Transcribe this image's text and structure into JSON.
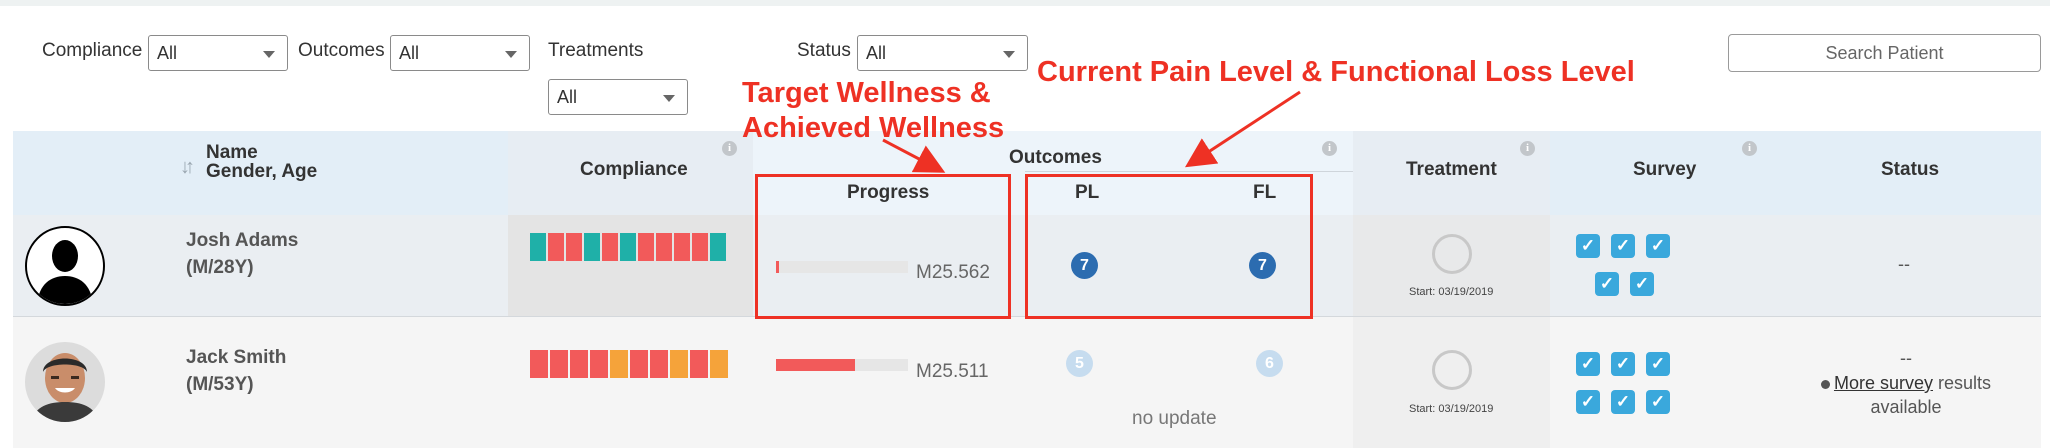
{
  "filters": {
    "compliance": {
      "label": "Compliance",
      "value": "All"
    },
    "outcomes": {
      "label": "Outcomes",
      "value": "All"
    },
    "treatments": {
      "label": "Treatments",
      "value": "All"
    },
    "status": {
      "label": "Status",
      "value": "All"
    },
    "search_label": "Search Patient"
  },
  "annotations": {
    "wellness_line1": "Target Wellness &",
    "wellness_line2": "Achieved Wellness",
    "pain": "Current Pain Level & Functional Loss Level"
  },
  "table": {
    "headers": {
      "name": "Name",
      "gender_age": "Gender, Age",
      "compliance": "Compliance",
      "outcomes": "Outcomes",
      "progress": "Progress",
      "pl": "PL",
      "fl": "FL",
      "treatment": "Treatment",
      "survey": "Survey",
      "status": "Status",
      "info_glyph": "i"
    },
    "rows": [
      {
        "name": "Josh Adams",
        "gender_age": "(M/28Y)",
        "avatar": "silhouette-avatar",
        "compliance_segments": [
          "#1fb0a8",
          "#f25a5a",
          "#f25a5a",
          "#1fb0a8",
          "#f25a5a",
          "#1fb0a8",
          "#f25a5a",
          "#f25a5a",
          "#f25a5a",
          "#f25a5a",
          "#1fb0a8"
        ],
        "progress_fraction": 0.02,
        "code": "M25.562",
        "pl": "7",
        "fl": "7",
        "treatment_start": "Start: 03/19/2019",
        "survey_checks": 5,
        "status": "--"
      },
      {
        "name": "Jack Smith",
        "gender_age": "(M/53Y)",
        "avatar": "photo-avatar",
        "compliance_segments": [
          "#f25a5a",
          "#f25a5a",
          "#f25a5a",
          "#f25a5a",
          "#f5a33a",
          "#f25a5a",
          "#f25a5a",
          "#f5a33a",
          "#f25a5a",
          "#f5a33a"
        ],
        "progress_fraction": 0.6,
        "code": "M25.511",
        "pl": "5",
        "fl": "6",
        "no_update": "no update",
        "treatment_start": "Start: 03/19/2019",
        "survey_checks": 6,
        "status": "--",
        "status_link": "More survey",
        "status_rest1": " results",
        "status_rest2": "available"
      }
    ]
  },
  "colors": {
    "header_bg": "#e3eef7",
    "outcomes_header_bg": "#edf4fa",
    "row1_bg": "#eaeef2",
    "row1_compliance_bg": "#e4e4e4",
    "row2_bg": "#f5f5f5",
    "badge_dark": "#2c6cb0",
    "badge_light": "#c6dcef",
    "annotation_red": "#ee3124",
    "check_blue": "#3aa8dc"
  }
}
